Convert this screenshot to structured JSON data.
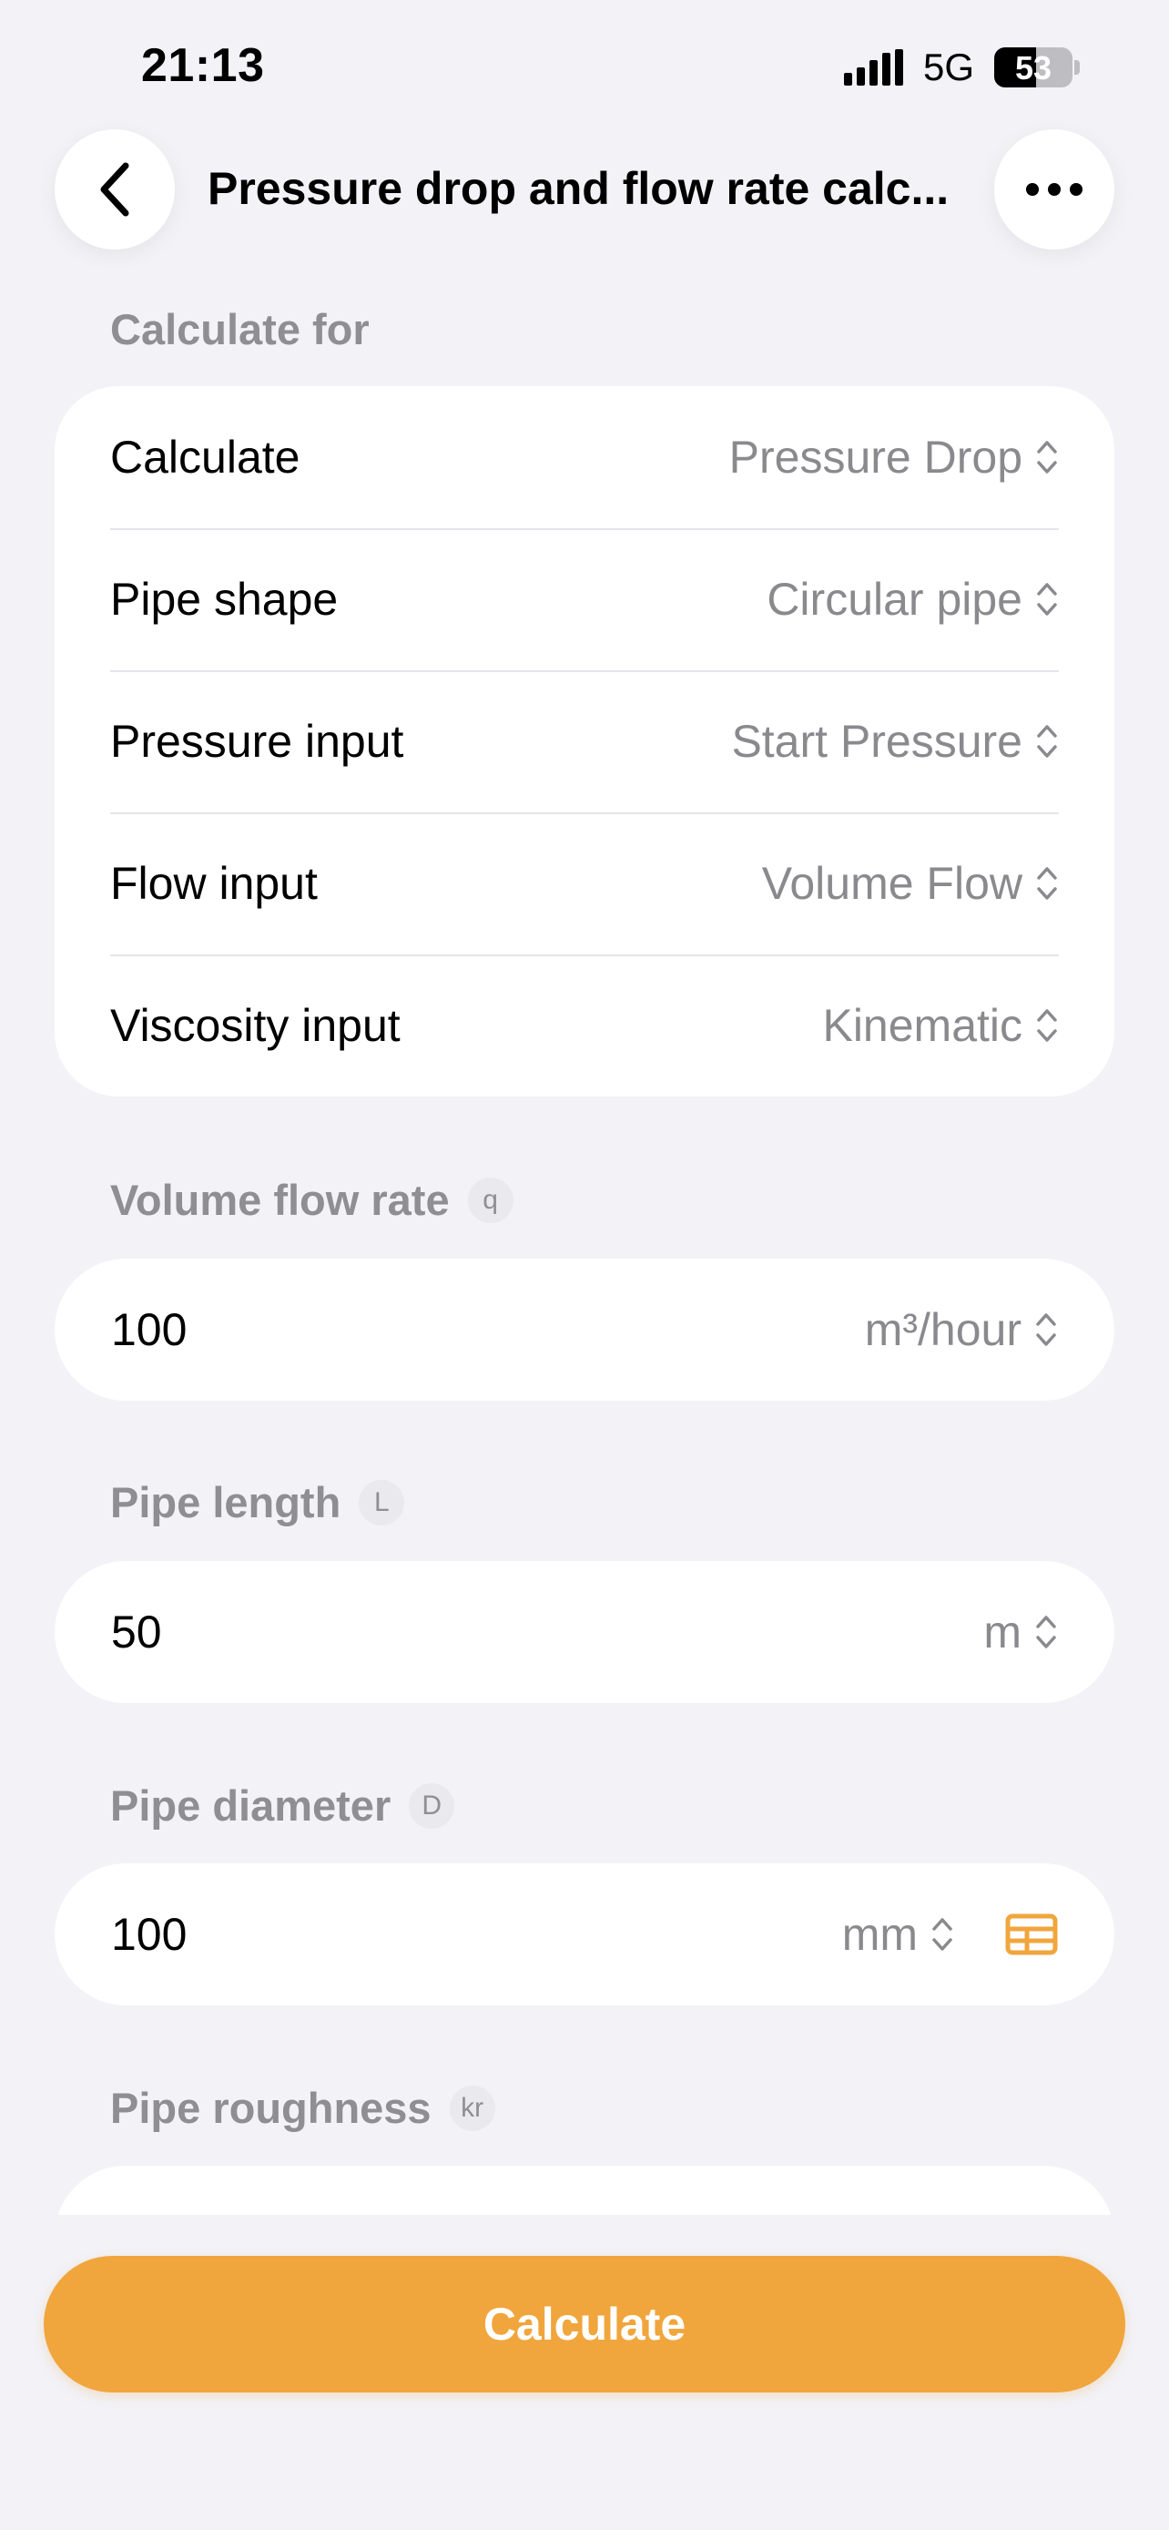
{
  "status_bar": {
    "time": "21:13",
    "network": "5G",
    "battery": "53"
  },
  "nav": {
    "title": "Pressure drop and flow rate calc..."
  },
  "calculate_for": {
    "section_label": "Calculate for",
    "rows": [
      {
        "label": "Calculate",
        "value": "Pressure Drop"
      },
      {
        "label": "Pipe shape",
        "value": "Circular pipe"
      },
      {
        "label": "Pressure input",
        "value": "Start Pressure"
      },
      {
        "label": "Flow input",
        "value": "Volume Flow"
      },
      {
        "label": "Viscosity input",
        "value": "Kinematic"
      }
    ]
  },
  "fields": {
    "volume_flow_rate": {
      "label": "Volume flow rate",
      "symbol": "q",
      "value": "100",
      "unit": "m³/hour"
    },
    "pipe_length": {
      "label": "Pipe length",
      "symbol": "L",
      "value": "50",
      "unit": "m"
    },
    "pipe_diameter": {
      "label": "Pipe diameter",
      "symbol": "D",
      "value": "100",
      "unit": "mm"
    },
    "pipe_roughness": {
      "label": "Pipe roughness",
      "symbol": "kr"
    }
  },
  "calculate_button": {
    "label": "Calculate"
  },
  "colors": {
    "accent": "#f0a63d",
    "background": "#f2f2f7",
    "secondary_text": "#8e8e93"
  }
}
